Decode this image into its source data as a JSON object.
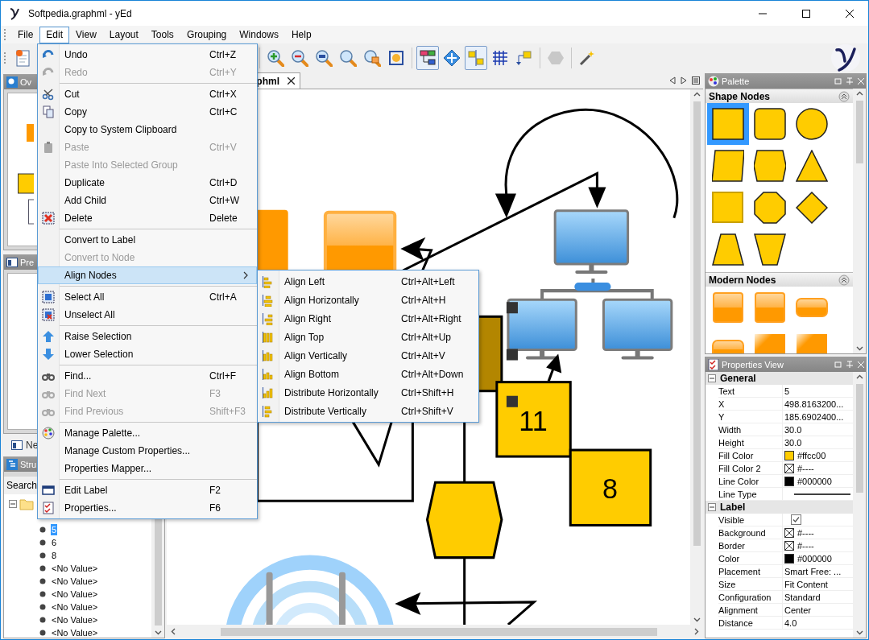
{
  "window": {
    "title": "Softpedia.graphml - yEd"
  },
  "menu_bar": [
    {
      "label": "File",
      "selected": false
    },
    {
      "label": "Edit",
      "selected": true
    },
    {
      "label": "View",
      "selected": false
    },
    {
      "label": "Layout",
      "selected": false
    },
    {
      "label": "Tools",
      "selected": false
    },
    {
      "label": "Grouping",
      "selected": false
    },
    {
      "label": "Windows",
      "selected": false
    },
    {
      "label": "Help",
      "selected": false
    }
  ],
  "toolbar": [
    {
      "kind": "new",
      "on": false,
      "disabled": false
    },
    {
      "kind": "zoom-in",
      "on": false,
      "disabled": false
    },
    {
      "kind": "zoom-out",
      "on": false,
      "disabled": false
    },
    {
      "kind": "zoom-actual",
      "on": false,
      "disabled": false
    },
    {
      "kind": "zoom",
      "on": false,
      "disabled": false
    },
    {
      "kind": "zoom-area",
      "on": false,
      "disabled": false
    },
    {
      "kind": "fit",
      "on": false,
      "disabled": false
    },
    {
      "kind": "hierarchy",
      "on": true,
      "disabled": false
    },
    {
      "kind": "move",
      "on": false,
      "disabled": false
    },
    {
      "kind": "snap",
      "on": true,
      "disabled": false
    },
    {
      "kind": "grid",
      "on": false,
      "disabled": false
    },
    {
      "kind": "port",
      "on": false,
      "disabled": false
    },
    {
      "kind": "group",
      "on": false,
      "disabled": true
    },
    {
      "kind": "wand",
      "on": false,
      "disabled": false
    }
  ],
  "edit_menu": {
    "groups": [
      {
        "items": [
          {
            "label": "Undo",
            "shortcut": "Ctrl+Z",
            "disabled": false,
            "selected": false,
            "submenu": false
          },
          {
            "label": "Redo",
            "shortcut": "Ctrl+Y",
            "disabled": true,
            "selected": false,
            "submenu": false
          }
        ]
      },
      {
        "items": [
          {
            "label": "Cut",
            "shortcut": "Ctrl+X",
            "disabled": false,
            "selected": false,
            "submenu": false
          },
          {
            "label": "Copy",
            "shortcut": "Ctrl+C",
            "disabled": false,
            "selected": false,
            "submenu": false
          },
          {
            "label": "Copy to System Clipboard",
            "disabled": false,
            "selected": false,
            "submenu": false
          },
          {
            "label": "Paste",
            "shortcut": "Ctrl+V",
            "disabled": true,
            "selected": false,
            "submenu": false
          },
          {
            "label": "Paste Into Selected Group",
            "disabled": true,
            "selected": false,
            "submenu": false
          },
          {
            "label": "Duplicate",
            "shortcut": "Ctrl+D",
            "disabled": false,
            "selected": false,
            "submenu": false
          },
          {
            "label": "Add Child",
            "shortcut": "Ctrl+W",
            "disabled": false,
            "selected": false,
            "submenu": false
          },
          {
            "label": "Delete",
            "shortcut": "Delete",
            "disabled": false,
            "selected": false,
            "submenu": false
          }
        ]
      },
      {
        "items": [
          {
            "label": "Convert to Label",
            "disabled": false,
            "selected": false,
            "submenu": false
          },
          {
            "label": "Convert to Node",
            "disabled": true,
            "selected": false,
            "submenu": false
          },
          {
            "label": "Align Nodes",
            "disabled": false,
            "selected": true,
            "submenu": true
          }
        ]
      },
      {
        "items": [
          {
            "label": "Select All",
            "shortcut": "Ctrl+A",
            "disabled": false,
            "selected": false,
            "submenu": false
          },
          {
            "label": "Unselect All",
            "disabled": false,
            "selected": false,
            "submenu": false
          }
        ]
      },
      {
        "items": [
          {
            "label": "Raise Selection",
            "disabled": false,
            "selected": false,
            "submenu": false
          },
          {
            "label": "Lower Selection",
            "disabled": false,
            "selected": false,
            "submenu": false
          }
        ]
      },
      {
        "items": [
          {
            "label": "Find...",
            "shortcut": "Ctrl+F",
            "disabled": false,
            "selected": false,
            "submenu": false
          },
          {
            "label": "Find Next",
            "shortcut": "F3",
            "disabled": true,
            "selected": false,
            "submenu": false
          },
          {
            "label": "Find Previous",
            "shortcut": "Shift+F3",
            "disabled": true,
            "selected": false,
            "submenu": false
          }
        ]
      },
      {
        "items": [
          {
            "label": "Manage Palette...",
            "disabled": false,
            "selected": false,
            "submenu": false
          },
          {
            "label": "Manage Custom Properties...",
            "disabled": false,
            "selected": false,
            "submenu": false
          },
          {
            "label": "Properties Mapper...",
            "disabled": false,
            "selected": false,
            "submenu": false
          }
        ]
      },
      {
        "items": [
          {
            "label": "Edit Label",
            "shortcut": "F2",
            "disabled": false,
            "selected": false,
            "submenu": false
          },
          {
            "label": "Properties...",
            "shortcut": "F6",
            "disabled": false,
            "selected": false,
            "submenu": false
          }
        ]
      }
    ]
  },
  "align_submenu": [
    {
      "label": "Align Left",
      "shortcut": "Ctrl+Alt+Left"
    },
    {
      "label": "Align Horizontally",
      "shortcut": "Ctrl+Alt+H"
    },
    {
      "label": "Align Right",
      "shortcut": "Ctrl+Alt+Right"
    },
    {
      "label": "Align Top",
      "shortcut": "Ctrl+Alt+Up"
    },
    {
      "label": "Align Vertically",
      "shortcut": "Ctrl+Alt+V"
    },
    {
      "label": "Align Bottom",
      "shortcut": "Ctrl+Alt+Down"
    },
    {
      "label": "Distribute Horizontally",
      "shortcut": "Ctrl+Shift+H"
    },
    {
      "label": "Distribute Vertically",
      "shortcut": "Ctrl+Shift+V"
    }
  ],
  "left_panels": {
    "overview": {
      "title": "Ov"
    },
    "preview": {
      "title": "Pre"
    },
    "neighborhood_tab": {
      "label": "Ne"
    },
    "structure": {
      "title": "Stru",
      "search_label": "Search",
      "tree": [
        {
          "expanded": true,
          "children": [
            {
              "label": "5",
              "selected": true
            },
            {
              "label": "6",
              "selected": false
            },
            {
              "label": "8",
              "selected": false
            },
            {
              "label": "<No Value>",
              "selected": false
            },
            {
              "label": "<No Value>",
              "selected": false
            },
            {
              "label": "<No Value>",
              "selected": false
            },
            {
              "label": "<No Value>",
              "selected": false
            },
            {
              "label": "<No Value>",
              "selected": false
            },
            {
              "label": "<No Value>",
              "selected": false
            }
          ]
        }
      ]
    }
  },
  "canvas": {
    "tab": {
      "label": "phml"
    },
    "node_labels": [
      "11",
      "8"
    ]
  },
  "palette": {
    "title": "Palette",
    "sections": [
      {
        "title": "Shape Nodes",
        "items": [
          {
            "kind": "rectangle",
            "selected": true
          },
          {
            "kind": "roundrect",
            "selected": false
          },
          {
            "kind": "ellipse",
            "selected": false
          },
          {
            "kind": "parallelogram",
            "selected": false
          },
          {
            "kind": "hexagon",
            "selected": false
          },
          {
            "kind": "triangle",
            "selected": false
          },
          {
            "kind": "rect3d",
            "selected": false
          },
          {
            "kind": "octagon",
            "selected": false
          },
          {
            "kind": "diamond",
            "selected": false
          },
          {
            "kind": "trapezoid",
            "selected": false
          },
          {
            "kind": "trapezoid2",
            "selected": false
          }
        ]
      },
      {
        "title": "Modern Nodes",
        "items": [
          {
            "kind": "glossy",
            "selected": false
          },
          {
            "kind": "glossy-shadow",
            "selected": false
          },
          {
            "kind": "pill",
            "selected": false
          },
          {
            "kind": "pill",
            "selected": false
          },
          {
            "kind": "corner",
            "selected": false
          },
          {
            "kind": "corner",
            "selected": false
          }
        ]
      }
    ]
  },
  "properties": {
    "title": "Properties View",
    "groups": [
      {
        "label": "General",
        "expanded": true,
        "rows": [
          {
            "name": "Text",
            "kind": "text",
            "value": "5"
          },
          {
            "name": "X",
            "kind": "text",
            "value": "498.8163200..."
          },
          {
            "name": "Y",
            "kind": "text",
            "value": "185.6902400..."
          },
          {
            "name": "Width",
            "kind": "text",
            "value": "30.0"
          },
          {
            "name": "Height",
            "kind": "text",
            "value": "30.0"
          },
          {
            "name": "Fill Color",
            "kind": "color",
            "color": "#ffcc00",
            "value": "#ffcc00"
          },
          {
            "name": "Fill Color 2",
            "kind": "nocolor",
            "value": "#----"
          },
          {
            "name": "Line Color",
            "kind": "color",
            "color": "#000000",
            "value": "#000000"
          },
          {
            "name": "Line Type",
            "kind": "line"
          }
        ]
      },
      {
        "label": "Label",
        "expanded": true,
        "rows": [
          {
            "name": "Visible",
            "kind": "checkbox",
            "checked": true
          },
          {
            "name": "Background",
            "kind": "nocolor",
            "value": "#----"
          },
          {
            "name": "Border",
            "kind": "nocolor",
            "value": "#----"
          },
          {
            "name": "Color",
            "kind": "color",
            "color": "#000000",
            "value": "#000000"
          },
          {
            "name": "Placement",
            "kind": "text",
            "value": "Smart Free: ..."
          },
          {
            "name": "Size",
            "kind": "text",
            "value": "Fit Content"
          },
          {
            "name": "Configuration",
            "kind": "text",
            "value": "Standard"
          },
          {
            "name": "Alignment",
            "kind": "text",
            "value": "Center"
          },
          {
            "name": "Distance",
            "kind": "text",
            "value": "4.0"
          }
        ]
      }
    ]
  }
}
